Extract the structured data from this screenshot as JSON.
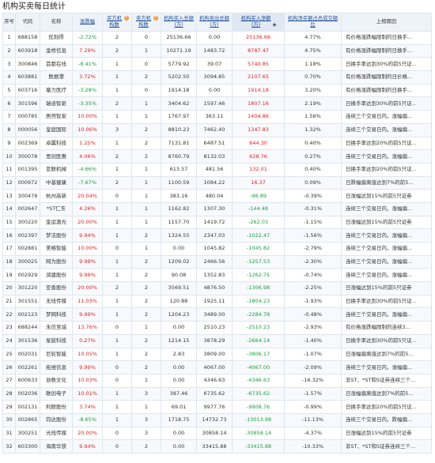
{
  "page_title": "机构买卖每日统计",
  "header": {
    "col_seq": "序号",
    "col_code": "代码",
    "col_name": "名称",
    "col_change": "涨跌幅",
    "col_buy_count": "买方机构数",
    "col_sell_count": "卖方机构数",
    "col_buy_amount": "机构买入总额(万)",
    "col_sell_amount": "机构卖出总额(万)",
    "col_net": "机构买入净额(万)",
    "col_ratio": "机构净买额占总成交额比",
    "col_reason": "上榜原因",
    "sort_glyph": "◆"
  },
  "rows": [
    {
      "seq": "1",
      "code": "688158",
      "name": "优刻得",
      "change": "-2.72%",
      "buy": "2",
      "sell": "0",
      "buy_amt": "25136.66",
      "sell_amt": "0.00",
      "net": "25136.66",
      "ratio": "4.77%",
      "reason": "有价格涨跌幅限制的日换手..."
    },
    {
      "seq": "2",
      "code": "603918",
      "name": "金桥信息",
      "change": "7.29%",
      "buy": "2",
      "sell": "1",
      "buy_amt": "10271.19",
      "sell_amt": "1483.72",
      "net": "8787.47",
      "ratio": "4.75%",
      "reason": "有价格涨跌幅限制的日换手..."
    },
    {
      "seq": "3",
      "code": "300846",
      "name": "首都在线",
      "change": "-8.41%",
      "buy": "1",
      "sell": "0",
      "buy_amt": "5779.92",
      "sell_amt": "39.07",
      "net": "5740.85",
      "ratio": "1.18%",
      "reason": "日换手率达到30%的前5只证..."
    },
    {
      "seq": "4",
      "code": "603881",
      "name": "数据港",
      "change": "3.72%",
      "buy": "1",
      "sell": "2",
      "buy_amt": "5202.50",
      "sell_amt": "3094.85",
      "net": "2107.65",
      "ratio": "0.70%",
      "reason": "有价格涨跌幅限制的日价格..."
    },
    {
      "seq": "5",
      "code": "603716",
      "name": "塞力医疗",
      "change": "-3.28%",
      "buy": "1",
      "sell": "0",
      "buy_amt": "1914.18",
      "sell_amt": "0.00",
      "net": "1914.18",
      "ratio": "3.20%",
      "reason": "有价格涨跌幅限制的日换手..."
    },
    {
      "seq": "6",
      "code": "301596",
      "name": "瑞迪智驱",
      "change": "-3.35%",
      "buy": "2",
      "sell": "1",
      "buy_amt": "3404.62",
      "sell_amt": "1597.46",
      "net": "1807.16",
      "ratio": "2.19%",
      "reason": "日换手率达到30%的前5只证..."
    },
    {
      "seq": "7",
      "code": "000785",
      "name": "居然智家",
      "change": "10.00%",
      "buy": "1",
      "sell": "1",
      "buy_amt": "1767.97",
      "sell_amt": "363.11",
      "net": "1404.86",
      "ratio": "1.56%",
      "reason": "连续三个交易日内，涨幅偏..."
    },
    {
      "seq": "8",
      "code": "000056",
      "name": "皇庭国际",
      "change": "10.06%",
      "buy": "3",
      "sell": "2",
      "buy_amt": "8810.23",
      "sell_amt": "7462.40",
      "net": "1347.83",
      "ratio": "1.32%",
      "reason": "连续三个交易日内，涨幅偏..."
    },
    {
      "seq": "9",
      "code": "002369",
      "name": "卓翼科技",
      "change": "1.25%",
      "buy": "1",
      "sell": "2",
      "buy_amt": "7131.81",
      "sell_amt": "6487.51",
      "net": "644.30",
      "ratio": "0.40%",
      "reason": "日换手率达到20%的前5只证..."
    },
    {
      "seq": "10",
      "code": "300078",
      "name": "思创医惠",
      "change": "4.06%",
      "buy": "2",
      "sell": "2",
      "buy_amt": "8760.79",
      "sell_amt": "8132.03",
      "net": "628.76",
      "ratio": "0.27%",
      "reason": "连续三个交易日内，涨幅偏..."
    },
    {
      "seq": "11",
      "code": "001395",
      "name": "亚联机械",
      "change": "-4.66%",
      "buy": "1",
      "sell": "1",
      "buy_amt": "613.57",
      "sell_amt": "481.56",
      "net": "132.01",
      "ratio": "0.40%",
      "reason": "日换手率达到20%的前5只证..."
    },
    {
      "seq": "12",
      "code": "000972",
      "name": "中基健康",
      "change": "-7.67%",
      "buy": "2",
      "sell": "1",
      "buy_amt": "1100.59",
      "sell_amt": "1084.22",
      "net": "16.37",
      "ratio": "0.09%",
      "reason": "日跌幅偏离值达到7%的前5..."
    },
    {
      "seq": "13",
      "code": "300478",
      "name": "杭州高新",
      "change": "20.04%",
      "buy": "0",
      "sell": "1",
      "buy_amt": "383.16",
      "sell_amt": "480.04",
      "net": "-96.89",
      "ratio": "-0.39%",
      "reason": "日涨幅达到15%的前5只证券"
    },
    {
      "seq": "14",
      "code": "002647",
      "name": "*ST仁东",
      "change": "4.26%",
      "buy": "1",
      "sell": "1",
      "buy_amt": "1162.82",
      "sell_amt": "1307.30",
      "net": "-144.48",
      "ratio": "-0.31%",
      "reason": "连续三个交易日内，涨幅偏..."
    },
    {
      "seq": "15",
      "code": "300220",
      "name": "金运激光",
      "change": "20.00%",
      "buy": "1",
      "sell": "1",
      "buy_amt": "1157.70",
      "sell_amt": "1419.72",
      "net": "-262.03",
      "ratio": "-1.15%",
      "reason": "日涨幅达到15%的前5只证券"
    },
    {
      "seq": "16",
      "code": "002397",
      "name": "梦洁股份",
      "change": "9.94%",
      "buy": "1",
      "sell": "2",
      "buy_amt": "1324.55",
      "sell_amt": "2347.03",
      "net": "-1022.47",
      "ratio": "-1.56%",
      "reason": "连续三个交易日内，涨幅偏..."
    },
    {
      "seq": "17",
      "code": "002881",
      "name": "美格智能",
      "change": "10.00%",
      "buy": "0",
      "sell": "1",
      "buy_amt": "0.00",
      "sell_amt": "1045.82",
      "net": "-1045.82",
      "ratio": "-2.79%",
      "reason": "连续三个交易日内，涨幅偏..."
    },
    {
      "seq": "18",
      "code": "300025",
      "name": "网为股份",
      "change": "9.99%",
      "buy": "1",
      "sell": "2",
      "buy_amt": "1209.02",
      "sell_amt": "2466.56",
      "net": "-1257.53",
      "ratio": "-2.30%",
      "reason": "连续三个交易日内，涨幅偏..."
    },
    {
      "seq": "19",
      "code": "002929",
      "name": "润建股份",
      "change": "9.99%",
      "buy": "1",
      "sell": "2",
      "buy_amt": "90.08",
      "sell_amt": "1352.83",
      "net": "-1262.75",
      "ratio": "-0.74%",
      "reason": "连续三个交易日内，涨幅偏..."
    },
    {
      "seq": "20",
      "code": "301220",
      "name": "亚香股份",
      "change": "20.00%",
      "buy": "2",
      "sell": "2",
      "buy_amt": "3569.51",
      "sell_amt": "4876.50",
      "net": "-1306.98",
      "ratio": "-2.25%",
      "reason": "日涨幅达到15%的前5只证券"
    },
    {
      "seq": "21",
      "code": "301551",
      "name": "无线传媒",
      "change": "11.03%",
      "buy": "1",
      "sell": "2",
      "buy_amt": "120.88",
      "sell_amt": "1925.11",
      "net": "-1804.23",
      "ratio": "-1.93%",
      "reason": "日换手率达到30%的前5只证..."
    },
    {
      "seq": "22",
      "code": "002123",
      "name": "梦网科技",
      "change": "9.99%",
      "buy": "1",
      "sell": "2",
      "buy_amt": "1204.23",
      "sell_amt": "3489.00",
      "net": "-2284.78",
      "ratio": "-0.48%",
      "reason": "连续三个交易日内，涨幅偏..."
    },
    {
      "seq": "23",
      "code": "688244",
      "name": "永信至诚",
      "change": "13.76%",
      "buy": "0",
      "sell": "1",
      "buy_amt": "0.00",
      "sell_amt": "2510.23",
      "net": "-2510.23",
      "ratio": "-2.93%",
      "reason": "有价格涨跌幅限制的连续3..."
    },
    {
      "seq": "24",
      "code": "301536",
      "name": "星宸科技",
      "change": "0.27%",
      "buy": "1",
      "sell": "2",
      "buy_amt": "1214.15",
      "sell_amt": "3878.29",
      "net": "-2664.14",
      "ratio": "-1.40%",
      "reason": "日换手率达到30%的前5只证..."
    },
    {
      "seq": "25",
      "code": "002031",
      "name": "巨轮智能",
      "change": "10.05%",
      "buy": "1",
      "sell": "2",
      "buy_amt": "2.83",
      "sell_amt": "3809.00",
      "net": "-3806.17",
      "ratio": "-1.07%",
      "reason": "日涨幅偏离值达到7%的前5..."
    },
    {
      "seq": "26",
      "code": "002261",
      "name": "拓维信息",
      "change": "9.99%",
      "buy": "0",
      "sell": "2",
      "buy_amt": "0.00",
      "sell_amt": "4067.00",
      "net": "-4067.00",
      "ratio": "-2.09%",
      "reason": "连续三个交易日内，涨幅偏..."
    },
    {
      "seq": "27",
      "code": "600633",
      "name": "浙数文化",
      "change": "10.03%",
      "buy": "0",
      "sell": "1",
      "buy_amt": "0.00",
      "sell_amt": "4346.63",
      "net": "-4346.63",
      "ratio": "-16.32%",
      "reason": "非ST、*ST和S证券连续三个..."
    },
    {
      "seq": "28",
      "code": "002036",
      "name": "联创电子",
      "change": "10.01%",
      "buy": "1",
      "sell": "3",
      "buy_amt": "387.46",
      "sell_amt": "6735.62",
      "net": "-6735.62",
      "ratio": "-1.57%",
      "reason": "日涨幅偏离值达到7%的前5..."
    },
    {
      "seq": "29",
      "code": "002131",
      "name": "利欧股份",
      "change": "3.74%",
      "buy": "1",
      "sell": "1",
      "buy_amt": "69.01",
      "sell_amt": "9977.76",
      "net": "-9908.76",
      "ratio": "-0.99%",
      "reason": "日换手率达到20%的前5只证..."
    },
    {
      "seq": "30",
      "code": "002865",
      "name": "钧达股份",
      "change": "-8.65%",
      "buy": "1",
      "sell": "3",
      "buy_amt": "1718.75",
      "sell_amt": "14732.73",
      "net": "-13013.98",
      "ratio": "-11.13%",
      "reason": "连续三个交易日内，跌幅偏..."
    },
    {
      "seq": "31",
      "code": "300251",
      "name": "光线传媒",
      "change": "20.00%",
      "buy": "0",
      "sell": "3",
      "buy_amt": "0.00",
      "sell_amt": "30858.14",
      "net": "-30858.14",
      "ratio": "-4.37%",
      "reason": "日涨幅达到15%的前5只证券"
    },
    {
      "seq": "32",
      "code": "603300",
      "name": "海南华铁",
      "change": "9.94%",
      "buy": "0",
      "sell": "2",
      "buy_amt": "0.00",
      "sell_amt": "33415.88",
      "net": "-33415.88",
      "ratio": "-10.33%",
      "reason": "非ST、*ST和S证券连续三个..."
    }
  ]
}
